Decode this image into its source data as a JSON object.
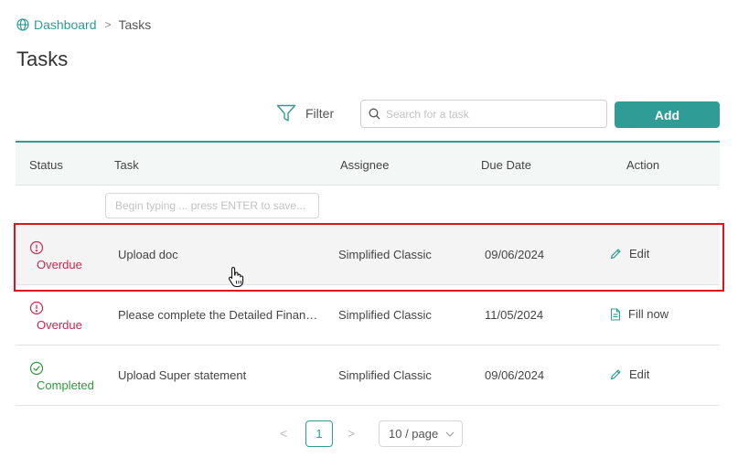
{
  "breadcrumb": {
    "home": "Dashboard",
    "separator": ">",
    "current": "Tasks"
  },
  "page": {
    "title": "Tasks"
  },
  "toolbar": {
    "filter_label": "Filter",
    "search_placeholder": "Search for a task",
    "add_label": "Add"
  },
  "table": {
    "columns": {
      "status": "Status",
      "task": "Task",
      "assignee": "Assignee",
      "due_date": "Due Date",
      "action": "Action"
    },
    "new_task_placeholder": "Begin typing ... press ENTER to save...",
    "rows": [
      {
        "status": "Overdue",
        "task": "Upload doc",
        "assignee": "Simplified Classic",
        "due_date": "09/06/2024",
        "action": "Edit"
      },
      {
        "status": "Overdue",
        "task": "Please complete the Detailed Financ...",
        "assignee": "Simplified Classic",
        "due_date": "11/05/2024",
        "action": "Fill now"
      },
      {
        "status": "Completed",
        "task": "Upload Super statement",
        "assignee": "Simplified Classic",
        "due_date": "09/06/2024",
        "action": "Edit"
      }
    ]
  },
  "pagination": {
    "prev": "<",
    "current_page": "1",
    "next": ">",
    "page_size": "10 / page"
  },
  "colors": {
    "accent": "#2f9c95",
    "overdue": "#c8274e",
    "completed": "#2e9a3d",
    "highlight": "#e2121b"
  },
  "icons": {
    "home": "globe-icon",
    "filter": "funnel-icon",
    "search": "search-icon",
    "overdue": "exclamation-circle-icon",
    "completed": "check-circle-icon",
    "edit": "pencil-icon",
    "fill": "document-icon",
    "dropdown": "chevron-down-icon"
  }
}
